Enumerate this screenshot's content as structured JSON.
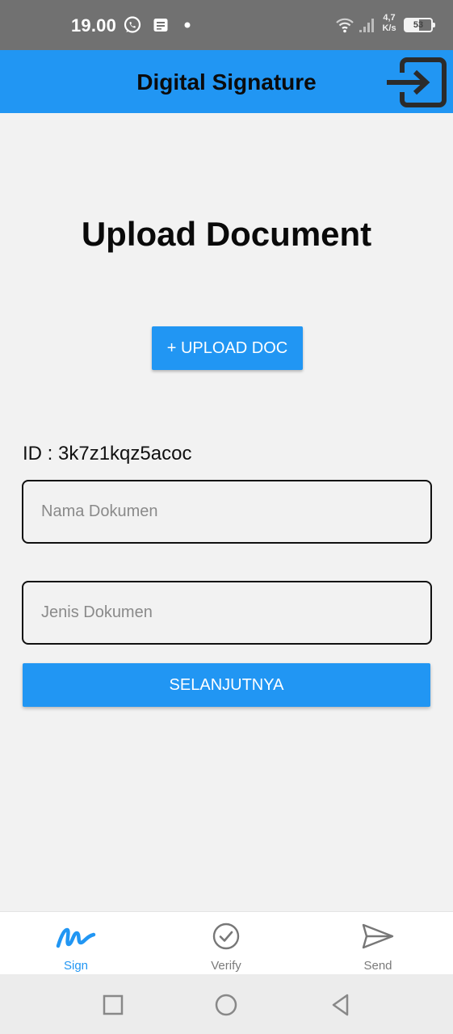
{
  "status_bar": {
    "time": "19.00",
    "net_speed_value": "4,7",
    "net_speed_unit": "K/s",
    "battery": "53",
    "icons": [
      "whatsapp-icon",
      "notes-icon",
      "dot-icon",
      "wifi-icon",
      "signal-icon",
      "battery-icon"
    ]
  },
  "app_bar": {
    "title": "Digital Signature",
    "action_icon": "logout-icon"
  },
  "main": {
    "heading": "Upload Document",
    "upload_button": "+ UPLOAD DOC",
    "document_id": "ID : 3k7z1kqz5acoc",
    "nama_placeholder": "Nama Dokumen",
    "jenis_placeholder": "Jenis Dokumen",
    "next_button": "SELANJUTNYA"
  },
  "bottom_nav": {
    "items": [
      {
        "label": "Sign",
        "icon": "signature-icon",
        "active": true
      },
      {
        "label": "Verify",
        "icon": "check-circle-icon",
        "active": false
      },
      {
        "label": "Send",
        "icon": "send-icon",
        "active": false
      }
    ]
  },
  "colors": {
    "primary": "#2196f3",
    "status_bar": "#717171",
    "background": "#f2f2f2"
  }
}
